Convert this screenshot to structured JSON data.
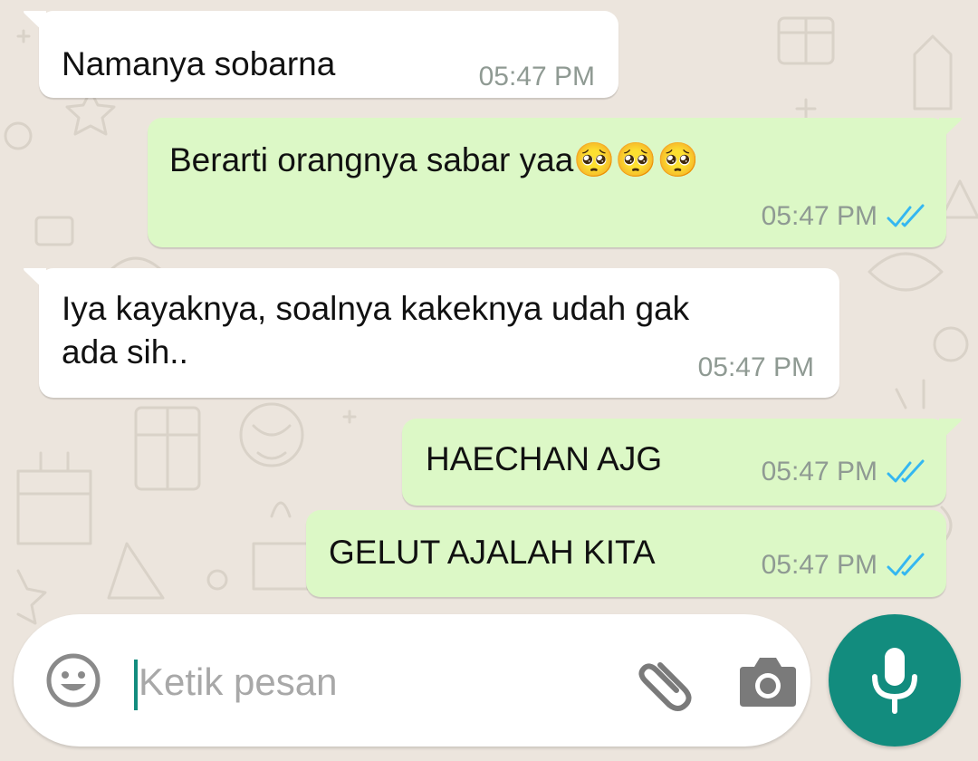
{
  "colors": {
    "wallpaper": "#ece5dd",
    "incoming_bubble": "#ffffff",
    "outgoing_bubble": "#dcf8c6",
    "read_tick": "#34b7f1",
    "accent": "#128c7e"
  },
  "messages": [
    {
      "direction": "incoming",
      "text": "Namanya sobarna",
      "time": "05:47 PM"
    },
    {
      "direction": "outgoing",
      "text": "Berarti orangnya sabar yaa🥺🥺🥺",
      "time": "05:47 PM",
      "status": "read"
    },
    {
      "direction": "incoming",
      "text_lines": [
        "Iya kayaknya, soalnya kakeknya udah gak",
        "ada sih.."
      ],
      "time": "05:47 PM"
    },
    {
      "direction": "outgoing",
      "text": "HAECHAN AJG",
      "time": "05:47 PM",
      "status": "read"
    },
    {
      "direction": "outgoing",
      "text": "GELUT AJALAH KITA",
      "time": "05:47 PM",
      "status": "read"
    }
  ],
  "composer": {
    "placeholder": "Ketik pesan",
    "value": "",
    "icons": [
      "emoji-icon",
      "paperclip-icon",
      "camera-icon",
      "microphone-icon"
    ]
  }
}
